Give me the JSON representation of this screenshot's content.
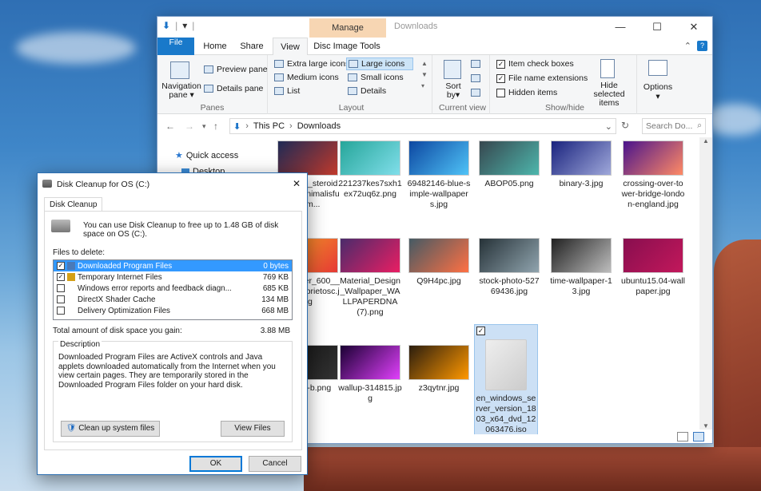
{
  "explorer": {
    "title": "Downloads",
    "qat_icon": "folder-arrow-icon",
    "manage_tab": "Manage",
    "tabs": [
      "File",
      "Home",
      "Share",
      "View",
      "Disc Image Tools"
    ],
    "active_tab": "View",
    "ribbon": {
      "panes": {
        "label": "Panes",
        "navigation_pane": "Navigation pane",
        "preview_pane": "Preview pane",
        "details_pane": "Details pane"
      },
      "layout": {
        "label": "Layout",
        "items": [
          "Extra large icons",
          "Large icons",
          "Medium icons",
          "Small icons",
          "List",
          "Details"
        ],
        "selected": "Large icons"
      },
      "current_view": {
        "label": "Current view",
        "sort_by": "Sort by"
      },
      "show_hide": {
        "label": "Show/hide",
        "item_check_boxes": "Item check boxes",
        "file_name_extensions": "File name extensions",
        "hidden_items": "Hidden items",
        "hide_selected": "Hide selected items",
        "checked": [
          true,
          true,
          false
        ]
      },
      "options": "Options"
    },
    "address": {
      "path": [
        "This PC",
        "Downloads"
      ],
      "search_placeholder": "Search Do..."
    },
    "nav": {
      "quick_access": "Quick access",
      "desktop": "Desktop"
    },
    "files": [
      {
        "name": "material_steroid_L-paminimalisful-sim...",
        "color1": "#1e2a55",
        "color2": "#c0392b"
      },
      {
        "name": "221237kes7sxh1ex72uq6z.png",
        "color1": "#26a69a",
        "color2": "#80deea"
      },
      {
        "name": "69482146-blue-simple-wallpapers.jpg",
        "color1": "#0d47a1",
        "color2": "#4fc3f7"
      },
      {
        "name": "ABOP05.png",
        "color1": "#37474f",
        "color2": "#4db6ac"
      },
      {
        "name": "binary-3.jpg",
        "color1": "#1a237e",
        "color2": "#9fa8da"
      },
      {
        "name": "crossing-over-tower-bridge-london-england.jpg",
        "color1": "#4a148c",
        "color2": "#ff8a65"
      },
      {
        "name": "wallpaper_600__very_gabrietosc.jpg",
        "color1": "#f9a825",
        "color2": "#e53935"
      },
      {
        "name": "Material_Design_Wallpaper_WALLPAPERDNA (7).png",
        "color1": "#4a2b6b",
        "color2": "#e91e63"
      },
      {
        "name": "Q9H4pc.jpg",
        "color1": "#455a64",
        "color2": "#ff7043"
      },
      {
        "name": "stock-photo-52769436.jpg",
        "color1": "#263238",
        "color2": "#90a4ae"
      },
      {
        "name": "time-wallpaper-13.jpg",
        "color1": "#212121",
        "color2": "#bdbdbd"
      },
      {
        "name": "ubuntu15.04-wallpaper.jpg",
        "color1": "#880e4f",
        "color2": "#c2185b"
      },
      {
        "name": "power-b.png",
        "color1": "#111111",
        "color2": "#333333"
      },
      {
        "name": "wallup-314815.jpg",
        "color1": "#1a0033",
        "color2": "#e040fb"
      },
      {
        "name": "z3qytnr.jpg",
        "color1": "#2b1d0e",
        "color2": "#ff9800"
      },
      {
        "name": "en_windows_server_version_1803_x64_dvd_12063476.iso",
        "color1": "#eeeeee",
        "color2": "#cccccc"
      }
    ]
  },
  "dialog": {
    "title": "Disk Cleanup for OS (C:)",
    "tab": "Disk Cleanup",
    "intro": "You can use Disk Cleanup to free up to 1.48 GB of disk space on OS (C:).",
    "files_to_delete_label": "Files to delete:",
    "files": [
      {
        "name": "Downloaded Program Files",
        "size": "0 bytes",
        "checked": true,
        "selected": true
      },
      {
        "name": "Temporary Internet Files",
        "size": "769 KB",
        "checked": true,
        "selected": false
      },
      {
        "name": "Windows error reports and feedback diagn...",
        "size": "685 KB",
        "checked": false,
        "selected": false
      },
      {
        "name": "DirectX Shader Cache",
        "size": "134 MB",
        "checked": false,
        "selected": false
      },
      {
        "name": "Delivery Optimization Files",
        "size": "668 MB",
        "checked": false,
        "selected": false
      }
    ],
    "total_label": "Total amount of disk space you gain:",
    "total_value": "3.88 MB",
    "description_label": "Description",
    "description": "Downloaded Program Files are ActiveX controls and Java applets downloaded automatically from the Internet when you view certain pages. They are temporarily stored in the Downloaded Program Files folder on your hard disk.",
    "clean_system": "Clean up system files",
    "view_files": "View Files",
    "ok": "OK",
    "cancel": "Cancel"
  }
}
